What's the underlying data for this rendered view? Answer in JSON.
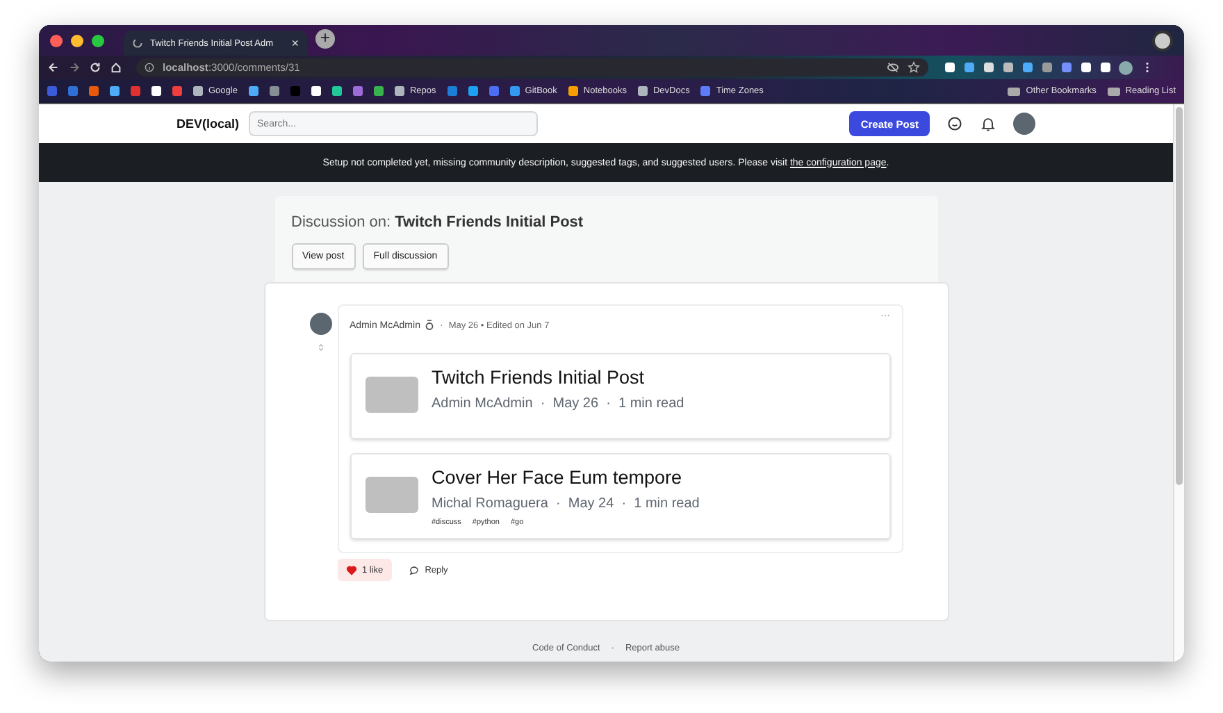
{
  "browser": {
    "tab": {
      "title": "Twitch Friends Initial Post Adm",
      "close": "×"
    },
    "new_tab": "+",
    "url": "**localhost**:3000/comments/31",
    "bookmarks": [
      {
        "color": "#3b5bdb"
      },
      {
        "color": "#2f6fd6"
      },
      {
        "color": "#e8590c"
      },
      {
        "color": "#4dabf7"
      },
      {
        "color": "#e03131"
      },
      {
        "color": "#ffffff"
      },
      {
        "color": "#f03e3e"
      },
      {
        "label": "Google",
        "color": "#adb5bd"
      },
      {
        "color": "#4dabf7"
      },
      {
        "color": "#868e96"
      },
      {
        "color": "#000000"
      },
      {
        "color": "#ffffff"
      },
      {
        "color": "#20c997"
      },
      {
        "color": "#9c6bd6"
      },
      {
        "color": "#37b24d"
      },
      {
        "label": "Repos",
        "color": "#adb5bd"
      },
      {
        "color": "#1c7ed6"
      },
      {
        "color": "#1da1f2"
      },
      {
        "color": "#4c6ef5"
      },
      {
        "label": "GitBook",
        "color": "#339af0"
      },
      {
        "label": "Notebooks",
        "color": "#f59f00"
      },
      {
        "label": "DevDocs",
        "color": "#adb5bd"
      },
      {
        "label": "Time Zones",
        "color": "#5c7cfa"
      }
    ],
    "bookmarks_right": [
      {
        "label": "Other Bookmarks"
      },
      {
        "label": "Reading List"
      }
    ]
  },
  "header": {
    "logo": "DEV(local)",
    "search": {
      "placeholder": "Search..."
    },
    "create_button": "Create Post"
  },
  "banner": {
    "text": "Setup not completed yet, missing community description, suggested tags, and suggested users. Please visit ",
    "link": "the configuration page",
    "end": "."
  },
  "discussion": {
    "prefix": "Discussion on:",
    "title": "Twitch Friends Initial Post",
    "buttons": [
      "View post",
      "Full discussion"
    ]
  },
  "comment": {
    "author": "Admin McAdmin",
    "separator": "·",
    "meta": "May 26 • Edited on Jun 7",
    "menu": "···",
    "embeds": [
      {
        "title": "Twitch Friends Initial Post",
        "byline": "Admin McAdmin  ·  May 26  ·  1 min read"
      },
      {
        "title": "Cover Her Face Eum tempore",
        "byline": "Michal Romaguera  ·  May 24  ·  1 min read",
        "tags": [
          "#discuss",
          "#python",
          "#go"
        ]
      }
    ],
    "likes": "1 like",
    "liked": true,
    "reply": "Reply"
  },
  "footer": {
    "links": [
      "Code of Conduct",
      "Report abuse"
    ],
    "separator": "·"
  }
}
